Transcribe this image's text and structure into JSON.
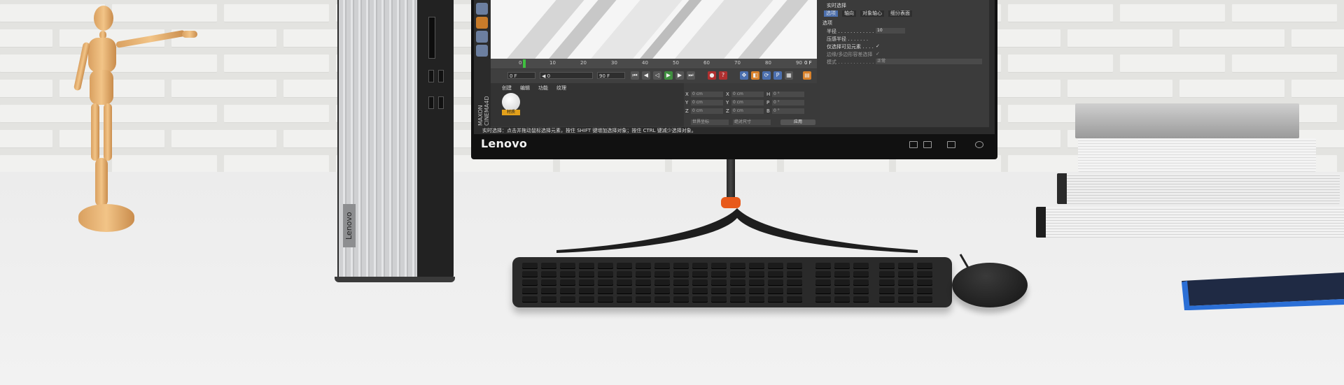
{
  "monitor": {
    "brand": "Lenovo",
    "screen": {
      "app_logo": "MAXON CINEMA4D",
      "attribute_panel": {
        "title": "实时选择",
        "tabs": [
          "选项",
          "轴向",
          "对象轴心",
          "细分表面"
        ],
        "section": "选项",
        "rows": [
          {
            "label": "半径 . . . . . . . . . . . . . . .",
            "value": "10"
          },
          {
            "label": "压感半径 . . . . . . .",
            "value": ""
          },
          {
            "label": "仅选择可见元素 . . . .",
            "value": "✓"
          },
          {
            "label": "边缘/多边形容差选择",
            "value": "✓"
          },
          {
            "label": "模式 . . . . . . . . . . . . .",
            "value": "正常"
          }
        ]
      },
      "timeline": {
        "ticks": [
          "0",
          "10",
          "20",
          "30",
          "40",
          "50",
          "60",
          "70",
          "80",
          "90"
        ],
        "end_frame": "0 F"
      },
      "transport": {
        "start": "0 F",
        "current": "◀ 0",
        "range_end": "90 F",
        "end": "90 F"
      },
      "material_panel": {
        "tabs": [
          "创建",
          "编辑",
          "功能",
          "纹理"
        ],
        "material_label": "材质"
      },
      "coordinate_panel": {
        "rows": [
          {
            "axis": "X",
            "pos": "0 cm",
            "axis2": "X",
            "size": "0 cm",
            "axis3": "H",
            "rot": "0 °"
          },
          {
            "axis": "Y",
            "pos": "0 cm",
            "axis2": "Y",
            "size": "0 cm",
            "axis3": "P",
            "rot": "0 °"
          },
          {
            "axis": "Z",
            "pos": "0 cm",
            "axis2": "Z",
            "size": "0 cm",
            "axis3": "B",
            "rot": "0 °"
          }
        ],
        "dropdown1": "世界坐标",
        "dropdown2": "绝对尺寸",
        "apply": "应用"
      },
      "status_bar": "实时选择：点击并拖动鼠标选择元素，按住 SHIFT 键增加选择对象；按住 CTRL 键减少选择对象。"
    }
  },
  "tower": {
    "brand": "Lenovo"
  },
  "colors": {
    "stand_ring": "#e85a1b",
    "material_label": "#e3a11b",
    "notebook": "#2b6fd6"
  }
}
